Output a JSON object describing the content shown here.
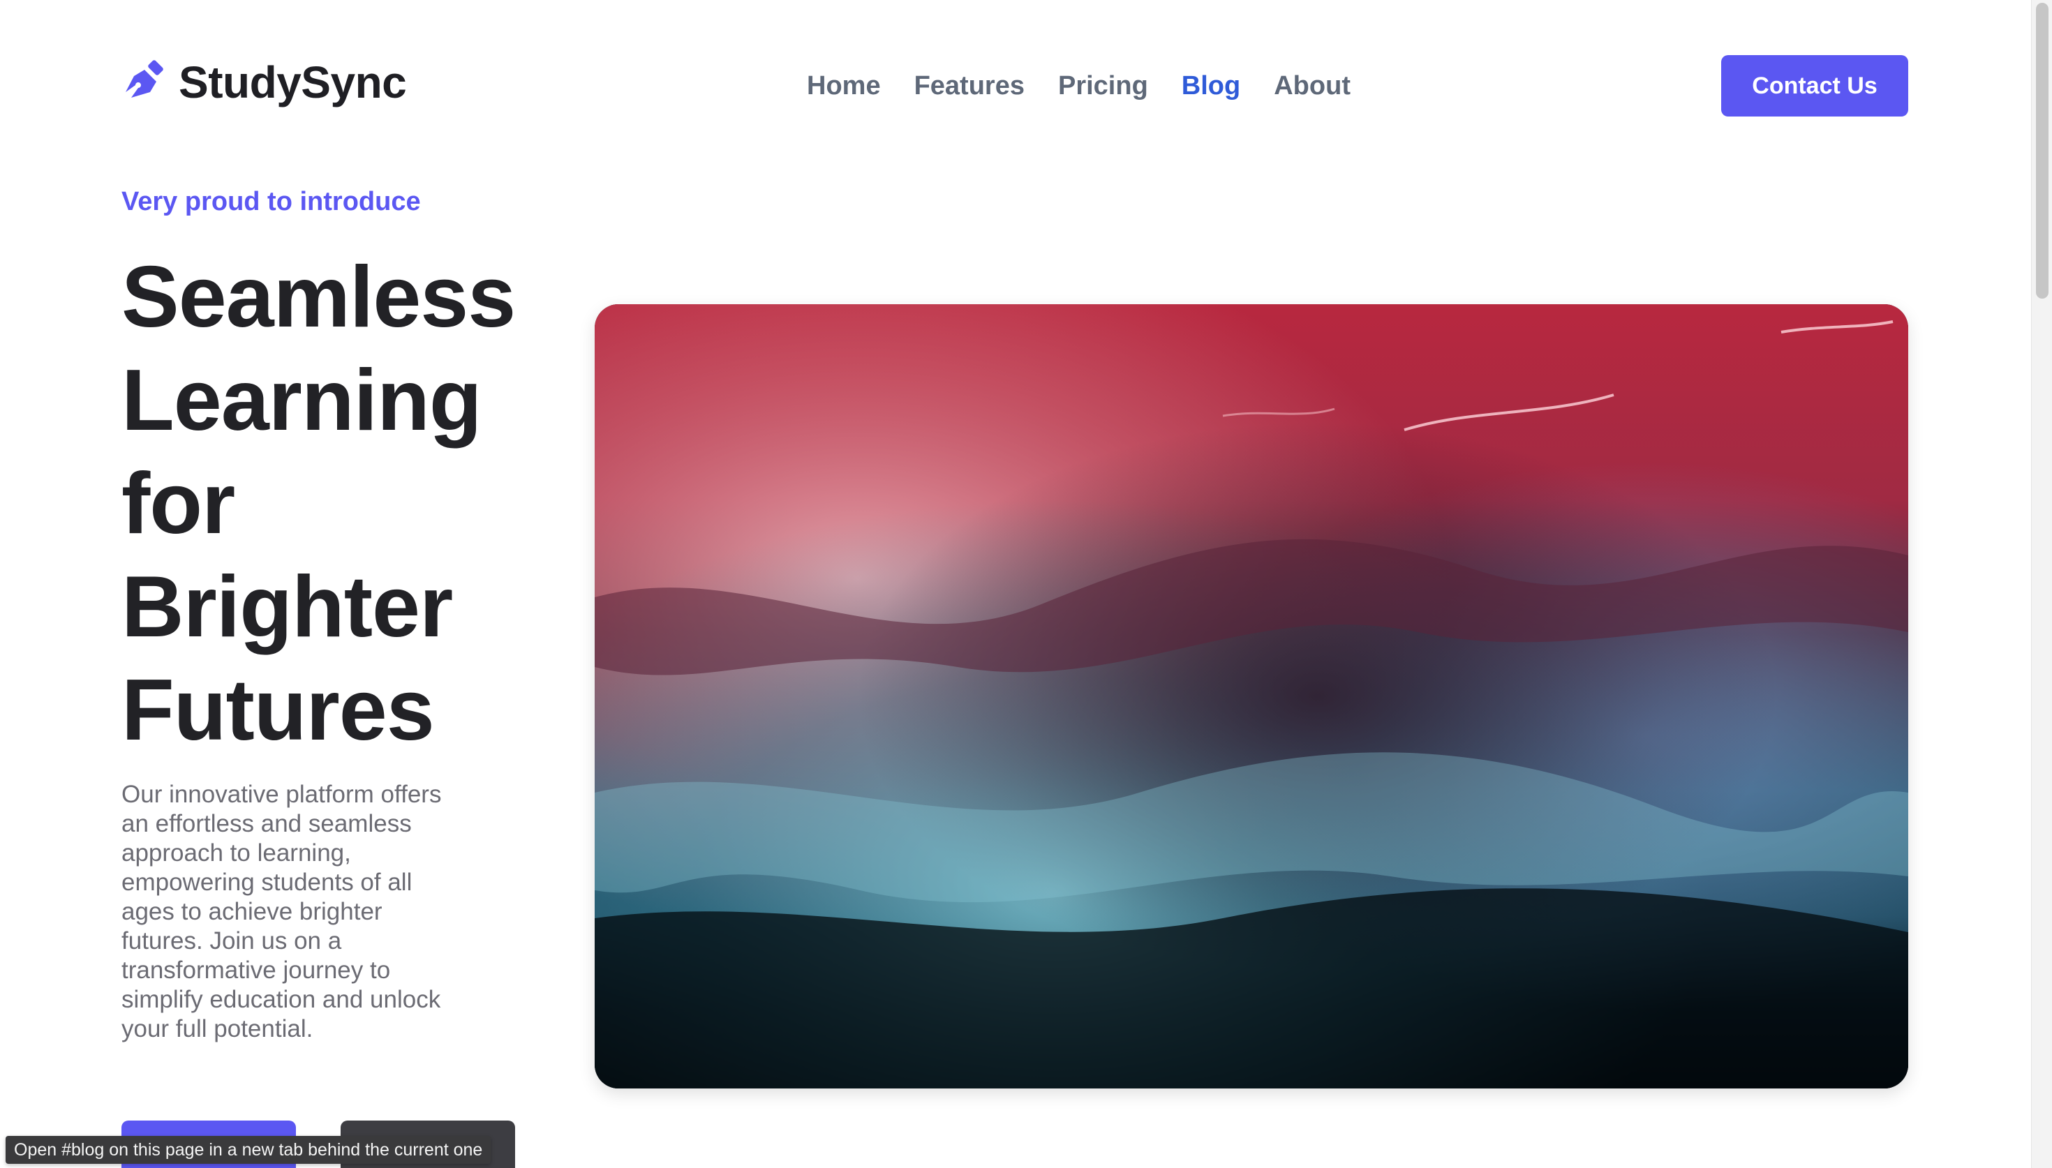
{
  "header": {
    "brand_name": "StudySync",
    "brand_icon": "pen-nib-icon",
    "nav": [
      {
        "label": "Home",
        "active": false
      },
      {
        "label": "Features",
        "active": false
      },
      {
        "label": "Pricing",
        "active": false
      },
      {
        "label": "Blog",
        "active": true
      },
      {
        "label": "About",
        "active": false
      }
    ],
    "contact_label": "Contact Us"
  },
  "hero": {
    "kicker": "Very proud to introduce",
    "title": "Seamless Learning for Brighter Futures",
    "description": "Our innovative platform offers an effortless and seamless approach to learning, empowering students of all ages to achieve brighter futures. Join us on a transformative journey to simplify education and unlock your full potential.",
    "primary_button_label": "",
    "secondary_button_label": "",
    "image_alt": "Abstract fluid art in red, pink and teal"
  },
  "status_bar": {
    "tooltip": "Open #blog on this page in a new tab behind the current one"
  },
  "colors": {
    "accent": "#5b57f2",
    "nav_active": "#2f5bd8",
    "nav_default": "#5e6878",
    "heading": "#222226",
    "body_text": "#6b6b73"
  }
}
